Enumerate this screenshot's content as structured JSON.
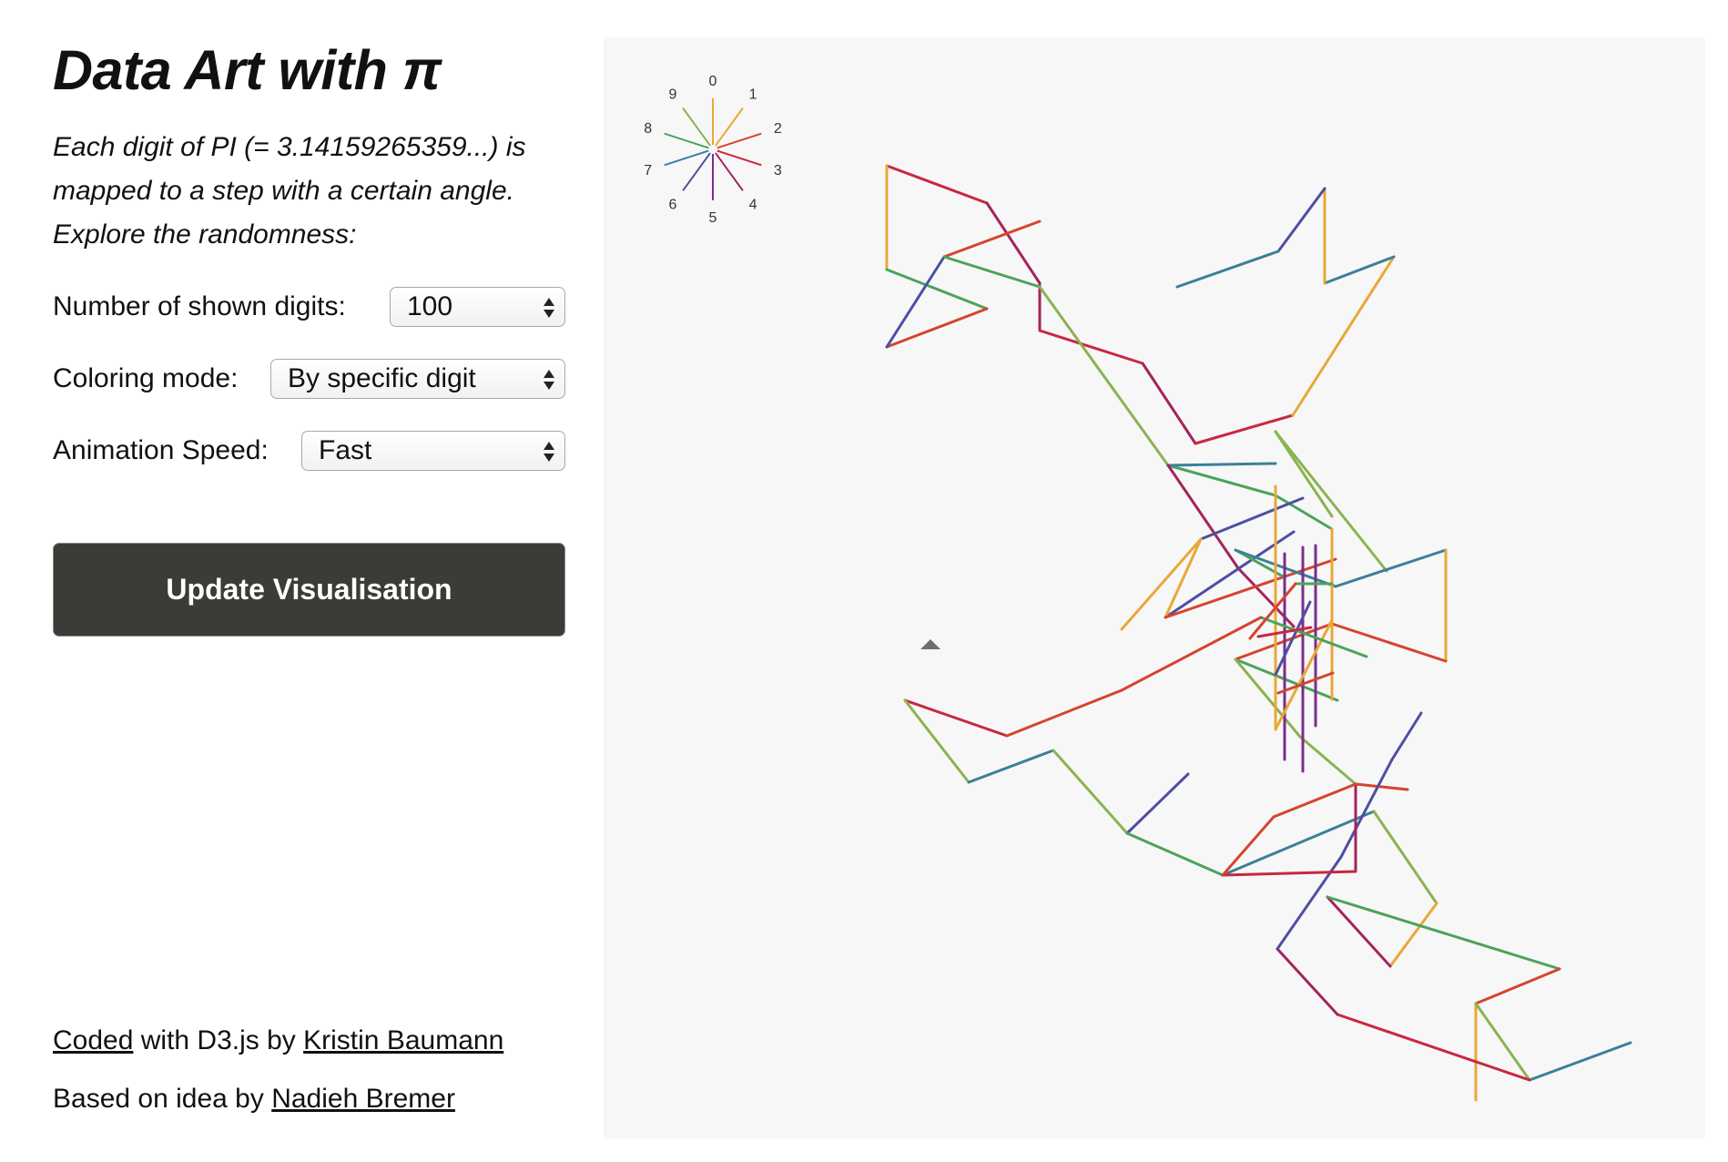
{
  "title": "Data Art with π",
  "description": [
    "Each digit of PI (= 3.14159265359...) is",
    "mapped to a step with a certain angle.",
    "Explore the randomness:"
  ],
  "controls": {
    "digits": {
      "label": "Number of shown digits:",
      "value": "100"
    },
    "coloring": {
      "label": "Coloring mode:",
      "value": "By specific digit"
    },
    "speed": {
      "label": "Animation Speed:",
      "value": "Fast"
    }
  },
  "update_button_label": "Update Visualisation",
  "footer": {
    "coded_link": "Coded",
    "coded_mid": " with D3.js by ",
    "author_link": "Kristin Baumann",
    "based_prefix": "Based on idea by ",
    "idea_link": "Nadieh Bremer"
  },
  "legend": {
    "digits": [
      "0",
      "1",
      "2",
      "3",
      "4",
      "5",
      "6",
      "7",
      "8",
      "9"
    ],
    "colors": [
      "#e8a838",
      "#e8a838",
      "#d6442f",
      "#c9283d",
      "#a3245e",
      "#7a2e8c",
      "#4d4fa3",
      "#3b8099",
      "#4ba35b",
      "#8ab352"
    ]
  },
  "indicator_icon": "triangle-marker-icon"
}
